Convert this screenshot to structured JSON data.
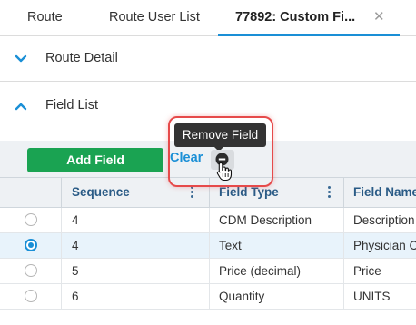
{
  "tabs": [
    {
      "label": "Route"
    },
    {
      "label": "Route User List"
    },
    {
      "label": "77892: Custom Fi...",
      "close": "✕"
    }
  ],
  "sections": {
    "route_detail": {
      "title": "Route Detail",
      "icon": "chevron-down-icon"
    },
    "field_list": {
      "title": "Field List",
      "icon": "chevron-up-icon"
    }
  },
  "toolbar": {
    "add_label": "Add Field",
    "clear_label": "Clear",
    "tooltip": "Remove Field"
  },
  "grid": {
    "columns": [
      "Sequence",
      "Field Type",
      "Field Name"
    ],
    "rows": [
      {
        "selected": false,
        "sequence": "4",
        "type": "CDM Description",
        "name": "Description"
      },
      {
        "selected": true,
        "sequence": "4",
        "type": "Text",
        "name": "Physician C"
      },
      {
        "selected": false,
        "sequence": "5",
        "type": "Price (decimal)",
        "name": "Price"
      },
      {
        "selected": false,
        "sequence": "6",
        "type": "Quantity",
        "name": "UNITS"
      }
    ]
  },
  "colors": {
    "accent": "#1a8fd6",
    "add_button": "#1aa352",
    "header_text": "#2a5b86",
    "highlight": "#e64a4a",
    "selected_row": "#e8f3fb"
  }
}
